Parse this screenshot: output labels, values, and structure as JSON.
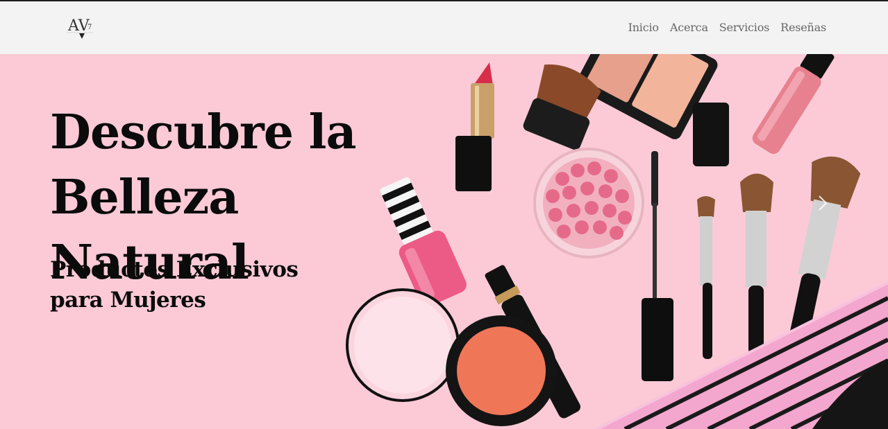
{
  "brand": {
    "logo_text": "AV",
    "logo_superscript": "7"
  },
  "nav": {
    "items": [
      {
        "label": "Inicio"
      },
      {
        "label": "Acerca"
      },
      {
        "label": "Servicios"
      },
      {
        "label": "Reseñas"
      }
    ]
  },
  "hero": {
    "title": "Descubre la Belleza Natural",
    "subtitle": "Productos Exclusivos para Mujeres",
    "image_icon": "makeup-products-image",
    "next_icon": "chevron-right-icon"
  },
  "colors": {
    "navbar_bg": "#f3f3f3",
    "hero_bg": "#fbcad6",
    "title_text": "#0b0b0b",
    "nav_text": "#666666"
  }
}
